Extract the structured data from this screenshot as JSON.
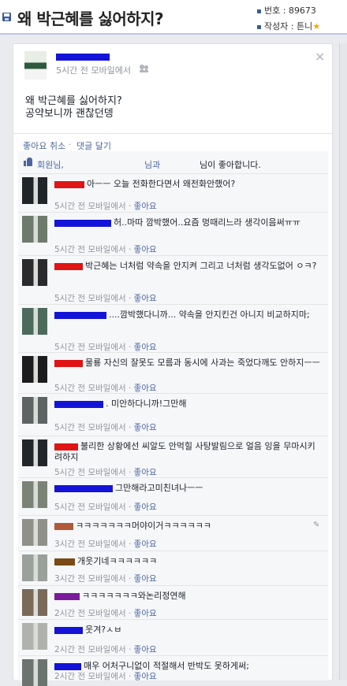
{
  "board": {
    "title": "왜 박근혜를 싫어하지?",
    "number_label": "번호 : 89673",
    "author_label": "작성자 : 튼니",
    "star": "★"
  },
  "post": {
    "time": "5시간 전 모바일에서",
    "body_line1": "왜 박근혜를 싫어하지?",
    "body_line2": "공약보니까 괜찮던뎅",
    "close_glyph": "×"
  },
  "actions": {
    "unlike": "좋아요 취소",
    "separator": "·",
    "comment": "댓글 달기"
  },
  "likes": {
    "name1": "회원님,",
    "name2": "님과",
    "suffix": "님이 좋아합니다."
  },
  "comments": [
    {
      "name_color": "#e01414",
      "text": "아ㅡㅡ 오늘 전화한다면서 왜전화안했어?",
      "meta": "5시간 전 모바일에서",
      "like": "좋아요"
    },
    {
      "name_color": "#1414d8",
      "text": "허..마따 깜박했어..요즘 멍때리느라 생각이음써ㅠㅠ",
      "meta": "5시간 전 모바일에서",
      "like": "좋아요"
    },
    {
      "name_color": "#e01414",
      "text": "박근혜는 너처럼 약속을 안지켜 그리고 너처럼 생각도없어 ㅇㅋ?",
      "meta": "5시간 전 모바일에서",
      "like": "좋아요"
    },
    {
      "name_color": "#1414d8",
      "text": "....깜박했다니까... 약속을 안지킨건 아니지 비교하지마;",
      "meta": "5시간 전 모바일에서",
      "like": "좋아요"
    },
    {
      "name_color": "#e01414",
      "text": "물룡 자신의 잘못도 모름과 동시에 사과는 죽었다깨도 안하지ㅡㅡ",
      "meta": "5시간 전 모바일에서",
      "like": "좋아요"
    },
    {
      "name_color": "#1414d8",
      "text": ". 미안하다니까!그만해",
      "meta": "5시간 전 모바일에서",
      "like": "좋아요"
    },
    {
      "name_color": "#e01414",
      "text": "불리한 상황에선 씨알도 안먹힐 사탕발림으로 얼음 잉을 무마시키려하지",
      "meta": "5시간 전 모바일에서",
      "like": "좋아요"
    },
    {
      "name_color": "#1414d8",
      "text": "그만해라고미친녀나ㅡㅡ",
      "meta": "5시간 전 모바일에서",
      "like": "좋아요"
    },
    {
      "name_color": "#b05a3a",
      "text": "ㅋㅋㅋㅋㅋㅋㅋ머야이거ㅋㅋㅋㅋㅋㅋ",
      "meta": "3시간 전 모바일에서",
      "like": "좋아요"
    },
    {
      "name_color": "#7a4a14",
      "text": "개웃기네ㅋㅋㅋㅋㅋㅋ",
      "meta": "3시간 전 모바일에서",
      "like": "좋아요"
    },
    {
      "name_color": "#7a1a9a",
      "text": "ㅋㅋㅋㅋㅋㅋㅋ와논리정연해",
      "meta": "2시간 전 모바일에서",
      "like": "좋아요"
    },
    {
      "name_color": "#1414d8",
      "text": "웃겨?ㅅㅂ",
      "meta": "2시간 전 모바일에서",
      "like": "좋아요"
    },
    {
      "name_color": "#1414d8",
      "text": "매우 어처구니없이 적절해서 반박도 못하게써;",
      "meta": "2시간 전 모바일에서",
      "like": "좋아요"
    }
  ]
}
